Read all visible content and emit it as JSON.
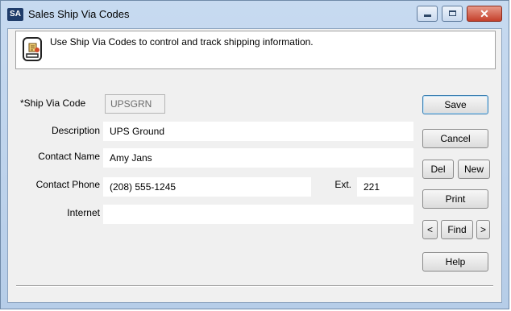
{
  "window": {
    "app_icon_text": "SA",
    "title": "Sales Ship Via Codes",
    "close_glyph": "✕"
  },
  "banner": {
    "text": "Use Ship Via Codes to control and track shipping information."
  },
  "form": {
    "ship_via_code_label": "*Ship Via Code",
    "ship_via_code_value": "UPSGRN",
    "description_label": "Description",
    "description_value": "UPS Ground",
    "contact_name_label": "Contact Name",
    "contact_name_value": "Amy Jans",
    "contact_phone_label": "Contact Phone",
    "contact_phone_value": "(208) 555-1245",
    "ext_label": "Ext.",
    "ext_value": "221",
    "internet_label": "Internet",
    "internet_value": ""
  },
  "buttons": {
    "save": "Save",
    "cancel": "Cancel",
    "del": "Del",
    "new": "New",
    "print": "Print",
    "prev": "<",
    "find": "Find",
    "next": ">",
    "help": "Help"
  },
  "colors": {
    "title_bar": "#b6cde8",
    "client_bg": "#f0f0f0",
    "default_button_border": "#3c7fb1",
    "close_button": "#c4402b"
  },
  "icons": {
    "app": "sa-app-icon",
    "banner": "document-info-icon",
    "minimize": "minimize-icon",
    "maximize": "maximize-icon",
    "close": "close-icon"
  }
}
